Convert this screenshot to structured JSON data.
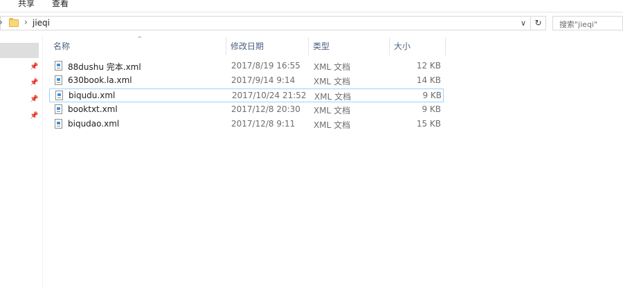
{
  "ribbon": {
    "tabs": [
      {
        "label": "共享"
      },
      {
        "label": "查看"
      }
    ]
  },
  "address": {
    "breadcrumb": "jieqi",
    "separator": "›",
    "refresh_symbol": "↻",
    "dropdown_symbol": "∨"
  },
  "search": {
    "placeholder": "搜索\"jieqi\""
  },
  "columns": {
    "name": "名称",
    "modified": "修改日期",
    "type": "类型",
    "size": "大小"
  },
  "files": [
    {
      "name": "88dushu  完本.xml",
      "modified": "2017/8/19 16:55",
      "type": "XML 文档",
      "size": "12 KB"
    },
    {
      "name": "630book.la.xml",
      "modified": "2017/9/14 9:14",
      "type": "XML 文档",
      "size": "14 KB"
    },
    {
      "name": "biqudu.xml",
      "modified": "2017/10/24 21:52",
      "type": "XML 文档",
      "size": "9 KB"
    },
    {
      "name": "booktxt.xml",
      "modified": "2017/12/8 20:30",
      "type": "XML 文档",
      "size": "9 KB"
    },
    {
      "name": "biqudao.xml",
      "modified": "2017/12/8 9:11",
      "type": "XML 文档",
      "size": "15 KB"
    }
  ],
  "selected_index": 2,
  "icons": {
    "pin": "pin-icon",
    "folder": "folder-icon",
    "file": "xml-file-icon"
  }
}
